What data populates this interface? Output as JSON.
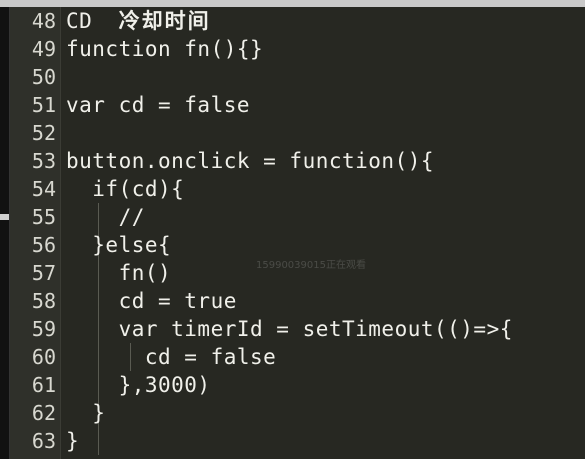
{
  "editor": {
    "lines": [
      {
        "num": "48",
        "code": "CD  ",
        "cn": "冷却时间"
      },
      {
        "num": "49",
        "code": "function fn(){}"
      },
      {
        "num": "50",
        "code": ""
      },
      {
        "num": "51",
        "code": "var cd = false"
      },
      {
        "num": "52",
        "code": ""
      },
      {
        "num": "53",
        "code": "button.onclick = function(){"
      },
      {
        "num": "54",
        "code": "  if(cd){"
      },
      {
        "num": "55",
        "code": "    //"
      },
      {
        "num": "56",
        "code": "  }else{"
      },
      {
        "num": "57",
        "code": "    fn()"
      },
      {
        "num": "58",
        "code": "    cd = true"
      },
      {
        "num": "59",
        "code": "    var timerId = setTimeout(()=>{"
      },
      {
        "num": "60",
        "code": "      cd = false"
      },
      {
        "num": "61",
        "code": "    },3000)"
      },
      {
        "num": "62",
        "code": "  }"
      },
      {
        "num": "63",
        "code": "}"
      }
    ]
  },
  "watermark": "15990039015正在观看",
  "colors": {
    "background": "#272822",
    "gutter": "#2f302a",
    "text": "#f0f0ea"
  }
}
